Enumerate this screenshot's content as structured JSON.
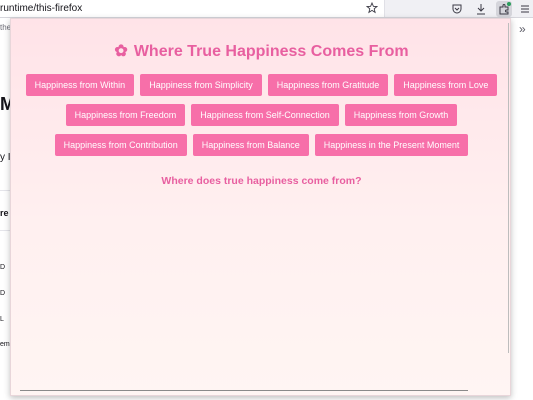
{
  "browser": {
    "url": "runtime/this-firefox",
    "icons": [
      "star-icon",
      "pocket-icon",
      "download-icon",
      "extension-icon",
      "menu-icon"
    ]
  },
  "background_page": {
    "tab_fragment": "the fi",
    "heading_fragment": "Mo",
    "text_fragment": "y I",
    "bold_fragment": "re",
    "row_fragments": [
      "D",
      "D",
      "L",
      "eme"
    ]
  },
  "popup": {
    "title": "Where True Happiness Comes From",
    "title_icon": "flower-icon",
    "buttons": [
      [
        "Happiness from Within",
        "Happiness from Simplicity",
        "Happiness from Gratitude",
        "Happiness from Love"
      ],
      [
        "Happiness from Freedom",
        "Happiness from Self-Connection",
        "Happiness from Growth"
      ],
      [
        "Happiness from Contribution",
        "Happiness from Balance",
        "Happiness in the Present Moment"
      ]
    ],
    "question": "Where does true happiness come from?"
  },
  "colors": {
    "accent": "#e85fa0",
    "button": "#f76fa9",
    "popup_bg_top": "#ffe3e8"
  }
}
